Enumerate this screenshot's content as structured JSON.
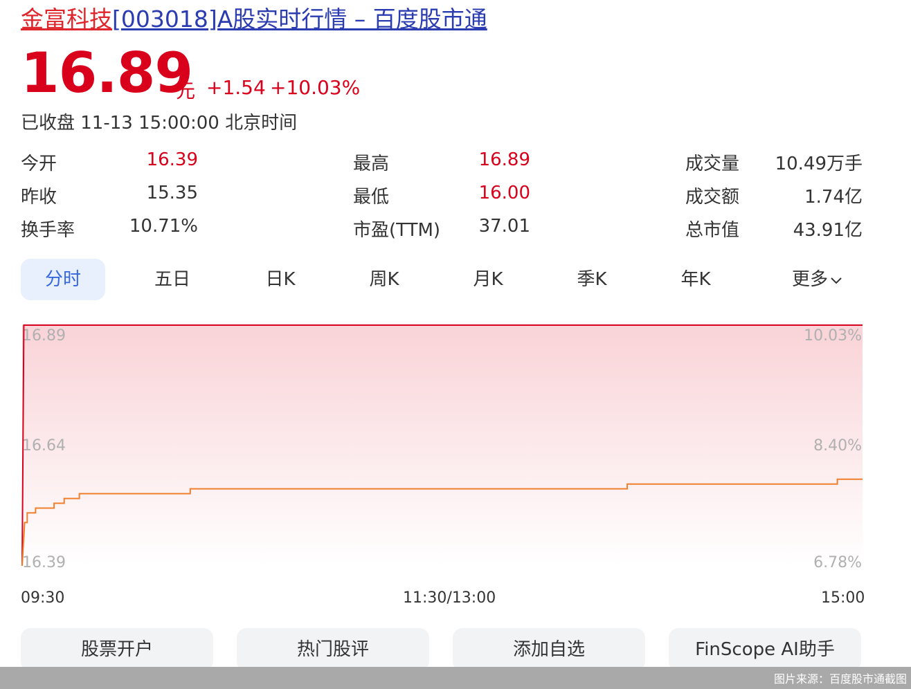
{
  "header": {
    "stock_name": "金富科技",
    "title_rest": "[003018]A股实时行情 – 百度股市通"
  },
  "quote": {
    "price": "16.89",
    "unit": "元",
    "change": "+1.54",
    "change_pct": "+10.03%",
    "status": "已收盘 11-13 15:00:00 北京时间"
  },
  "stats": [
    {
      "label": "今开",
      "value": "16.39"
    },
    {
      "label": "最高",
      "value": "16.89"
    },
    {
      "label": "成交量",
      "value": "10.49万手"
    },
    {
      "label": "昨收",
      "value": "15.35"
    },
    {
      "label": "最低",
      "value": "16.00"
    },
    {
      "label": "成交额",
      "value": "1.74亿"
    },
    {
      "label": "换手率",
      "value": "10.71%"
    },
    {
      "label": "市盈(TTM)",
      "value": "37.01"
    },
    {
      "label": "总市值",
      "value": "43.91亿"
    }
  ],
  "tabs": [
    "分时",
    "五日",
    "日K",
    "周K",
    "月K",
    "季K",
    "年K",
    "更多"
  ],
  "chart_data": {
    "type": "line",
    "y_left_ticks": [
      "16.89",
      "16.64",
      "16.39"
    ],
    "y_right_ticks": [
      "10.03%",
      "8.40%",
      "6.78%"
    ],
    "x_ticks": [
      "09:30",
      "11:30/13:00",
      "15:00"
    ],
    "ylim": [
      16.39,
      16.89
    ],
    "series": [
      {
        "color": "#d9001b",
        "values": [
          [
            0,
            16.39
          ],
          [
            0.002,
            16.89
          ],
          [
            1,
            16.89
          ]
        ]
      },
      {
        "color": "#f07f2b",
        "values": [
          [
            0,
            16.39
          ],
          [
            0.003,
            16.48
          ],
          [
            0.006,
            16.5
          ],
          [
            0.016,
            16.51
          ],
          [
            0.038,
            16.52
          ],
          [
            0.05,
            16.53
          ],
          [
            0.068,
            16.54
          ],
          [
            0.2,
            16.55
          ],
          [
            0.68,
            16.55
          ],
          [
            0.72,
            16.56
          ],
          [
            0.96,
            16.56
          ],
          [
            0.97,
            16.57
          ],
          [
            1,
            16.57
          ]
        ]
      }
    ]
  },
  "buttons": [
    "股票开户",
    "热门股评",
    "添加自选",
    "FinScope AI助手"
  ],
  "footer": "图片来源：百度股市通截图"
}
